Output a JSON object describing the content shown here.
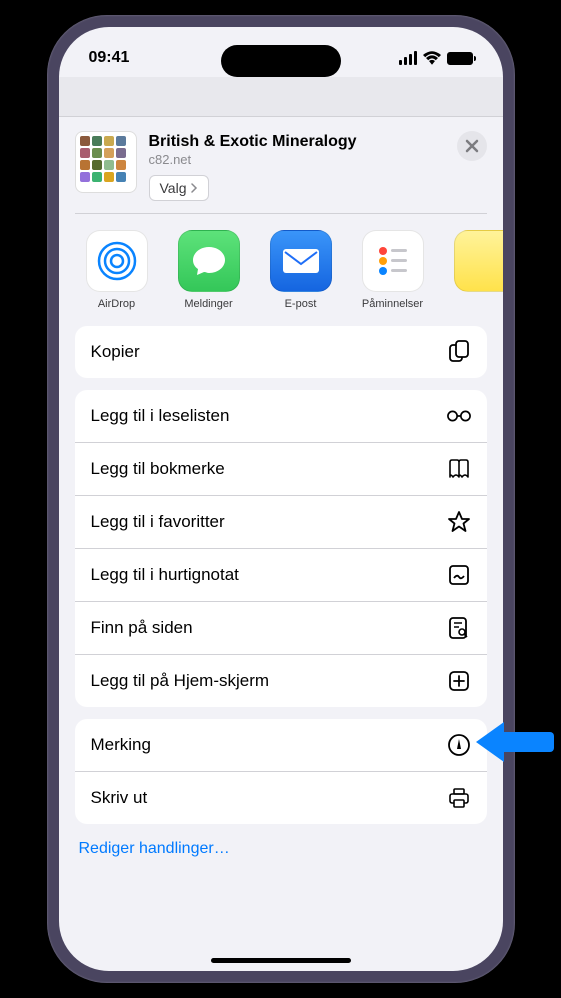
{
  "status": {
    "time": "09:41"
  },
  "share": {
    "title": "British & Exotic Mineralogy",
    "subtitle": "c82.net",
    "options_label": "Valg"
  },
  "apps": [
    {
      "name": "AirDrop",
      "bg": "#ffffff"
    },
    {
      "name": "Meldinger",
      "bg": "#34c759"
    },
    {
      "name": "E-post",
      "bg": "#1f6ef7"
    },
    {
      "name": "Påminnelser",
      "bg": "#ffffff"
    }
  ],
  "actions": {
    "copy": "Kopier",
    "reading_list": "Legg til i leselisten",
    "bookmark": "Legg til bokmerke",
    "favorites": "Legg til i favoritter",
    "quicknote": "Legg til i hurtignotat",
    "find": "Finn på siden",
    "homescreen": "Legg til på Hjem-skjerm",
    "markup": "Merking",
    "print": "Skriv ut",
    "edit": "Rediger handlinger…"
  }
}
